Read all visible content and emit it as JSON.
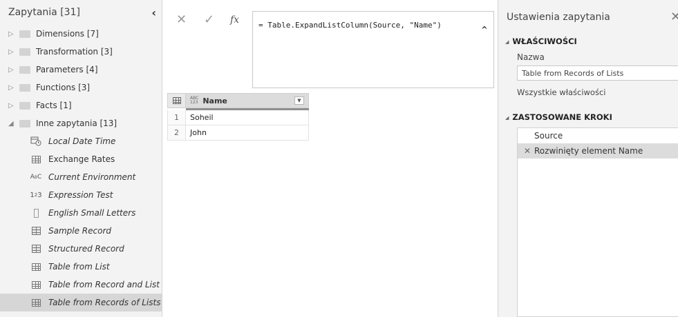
{
  "queries_pane": {
    "title": "Zapytania [31]",
    "collapse_icon": "chevron-left-icon",
    "groups": [
      {
        "label": "Dimensions [7]",
        "expanded": false
      },
      {
        "label": "Transformation [3]",
        "expanded": false
      },
      {
        "label": "Parameters [4]",
        "expanded": false
      },
      {
        "label": "Functions [3]",
        "expanded": false
      },
      {
        "label": "Facts [1]",
        "expanded": false
      },
      {
        "label": "Inne zapytania [13]",
        "expanded": true
      }
    ],
    "queries": [
      {
        "label": "Local Date Time",
        "icon": "datetime-icon",
        "italic": true
      },
      {
        "label": "Exchange Rates",
        "icon": "table-icon",
        "italic": false
      },
      {
        "label": "Current Environment",
        "icon": "text-type-icon",
        "italic": true
      },
      {
        "label": "Expression Test",
        "icon": "number-type-icon",
        "italic": true
      },
      {
        "label": "English Small Letters",
        "icon": "list-icon",
        "italic": true
      },
      {
        "label": "Sample Record",
        "icon": "record-icon",
        "italic": true
      },
      {
        "label": "Structured Record",
        "icon": "record-icon",
        "italic": true
      },
      {
        "label": "Table from List",
        "icon": "table-icon",
        "italic": true
      },
      {
        "label": "Table from Record and List",
        "icon": "table-icon",
        "italic": true
      },
      {
        "label": "Table from Records of Lists",
        "icon": "table-icon",
        "italic": true,
        "selected": true
      }
    ]
  },
  "formula_bar": {
    "formula": "= Table.ExpandListColumn(Source, \"Name\")",
    "fx_label": "fx"
  },
  "grid": {
    "column_type_badge": [
      "ABC",
      "123"
    ],
    "column_name": "Name",
    "rows": [
      {
        "num": "1",
        "value": "Soheil"
      },
      {
        "num": "2",
        "value": "John"
      }
    ]
  },
  "settings_pane": {
    "title": "Ustawienia zapytania",
    "properties_header": "WŁAŚCIWOŚCI",
    "name_label": "Nazwa",
    "name_value": "Table from Records of Lists",
    "all_properties_link": "Wszystkie właściwości",
    "steps_header": "ZASTOSOWANE KROKI",
    "steps": [
      {
        "label": "Source",
        "selected": false
      },
      {
        "label": "Rozwinięty element Name",
        "selected": true
      }
    ]
  },
  "colors": {
    "pane_bg": "#f3f3f3",
    "selected_bg": "#d6d6d6",
    "folder": "#d3d3d3"
  }
}
